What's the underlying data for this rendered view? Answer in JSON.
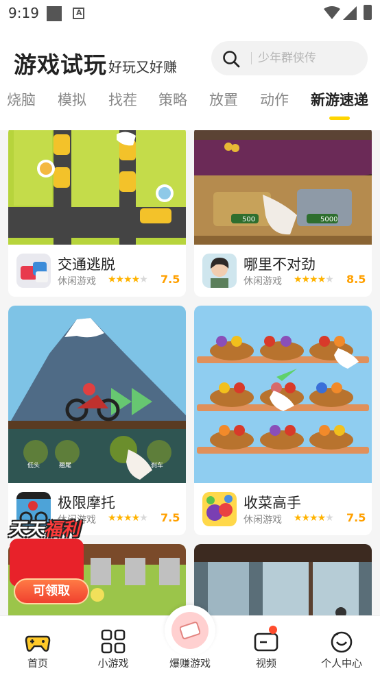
{
  "status_bar": {
    "time": "9:19"
  },
  "header": {
    "title": "游戏试玩",
    "subtitle": "好玩又好赚"
  },
  "search": {
    "placeholder": "少年群侠传"
  },
  "tabs": [
    "烧脑",
    "模拟",
    "找茬",
    "策略",
    "放置",
    "动作",
    "新游速递"
  ],
  "active_tab": "新游速递",
  "games": [
    {
      "name": "交通逃脱",
      "category": "休闲游戏",
      "rating": "7.5",
      "stars": 3.5
    },
    {
      "name": "哪里不对劲",
      "category": "休闲游戏",
      "rating": "8.5",
      "stars": 4
    },
    {
      "name": "极限摩托",
      "category": "休闲游戏",
      "rating": "7.5",
      "stars": 3.5
    },
    {
      "name": "收菜高手",
      "category": "休闲游戏",
      "rating": "7.5",
      "stars": 3.5
    }
  ],
  "thumb_text": {
    "coin_500": "500",
    "coin_5000": "5000",
    "moto_btn_left": "低头",
    "moto_btn_left2": "翘尾",
    "moto_btn_right": "刹车"
  },
  "promo": {
    "title_a": "天天",
    "title_b": "福利",
    "button": "可领取"
  },
  "bottom_nav": [
    {
      "label": "首页",
      "icon": "gamepad-icon"
    },
    {
      "label": "小游戏",
      "icon": "grid-icon"
    },
    {
      "label": "爆赚游戏",
      "icon": "cash-icon"
    },
    {
      "label": "视频",
      "icon": "video-icon"
    },
    {
      "label": "个人中心",
      "icon": "smile-icon"
    }
  ],
  "colors": {
    "accent": "#ffd500",
    "rating": "#ffa000",
    "star": "#ffb300"
  }
}
